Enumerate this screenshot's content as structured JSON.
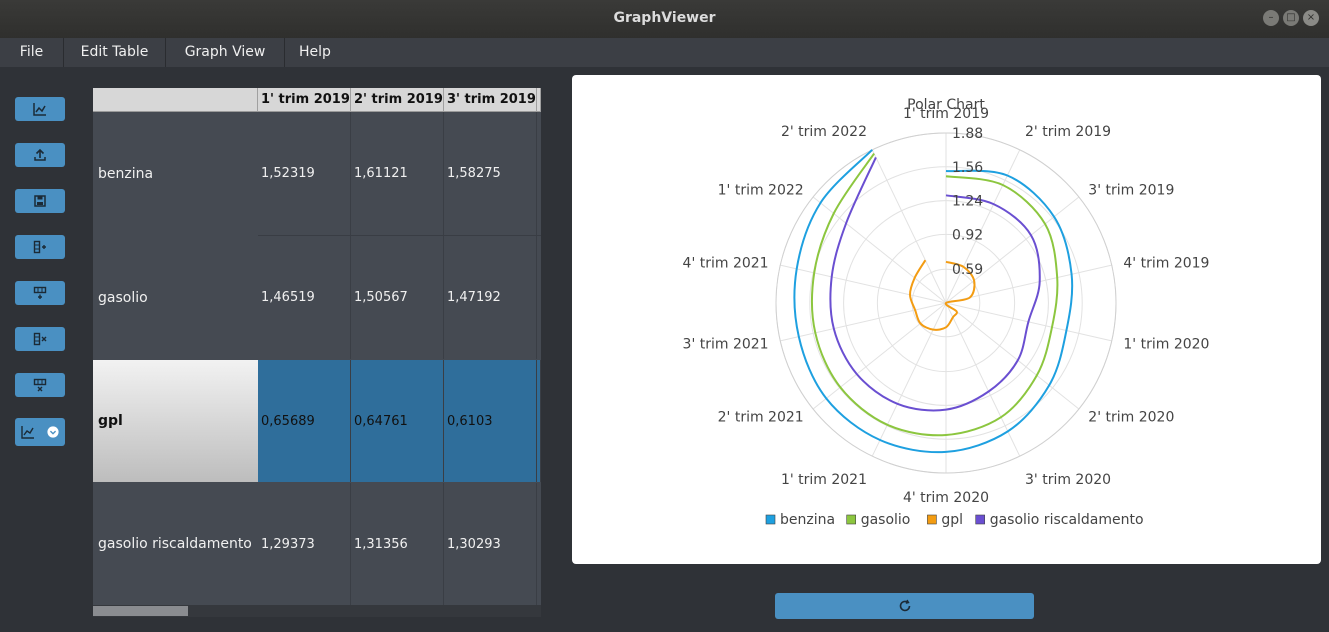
{
  "window": {
    "title": "GraphViewer"
  },
  "menu": [
    {
      "label": "File"
    },
    {
      "label": "Edit Table"
    },
    {
      "label": "Graph View"
    },
    {
      "label": "Help"
    }
  ],
  "toolbar": [
    {
      "icon": "chart-icon"
    },
    {
      "icon": "upload-icon"
    },
    {
      "icon": "save-icon"
    },
    {
      "icon": "add-column-icon"
    },
    {
      "icon": "add-row-icon"
    },
    {
      "icon": "remove-column-icon"
    },
    {
      "icon": "remove-row-icon"
    },
    {
      "icon": "chart-type-dropdown-icon"
    }
  ],
  "table": {
    "columns": [
      "1' trim 2019",
      "2' trim 2019",
      "3' trim 2019"
    ],
    "rows": [
      {
        "name": "benzina",
        "values": [
          "1,52319",
          "1,61121",
          "1,58275"
        ]
      },
      {
        "name": "gasolio",
        "values": [
          "1,46519",
          "1,50567",
          "1,47192"
        ]
      },
      {
        "name": "gpl",
        "values": [
          "0,65689",
          "0,64761",
          "0,6103"
        ]
      },
      {
        "name": "gasolio riscaldamento",
        "values": [
          "1,29373",
          "1,31356",
          "1,30293"
        ]
      }
    ],
    "selected_row": 2
  },
  "colors": {
    "accent": "#4a90c2",
    "selected_row": "#2f6e9b",
    "benzina": "#1ea0e0",
    "gasolio": "#8cc63f",
    "gpl": "#f39c12",
    "gasolio_riscaldamento": "#6a4fd1"
  },
  "chart_data": {
    "type": "polar",
    "title": "Polar Chart",
    "categories": [
      "1' trim 2019",
      "2' trim 2019",
      "3' trim 2019",
      "4' trim 2019",
      "1' trim 2020",
      "2' trim 2020",
      "3' trim 2020",
      "4' trim 2020",
      "1' trim 2021",
      "2' trim 2021",
      "3' trim 2021",
      "4' trim 2021",
      "1' trim 2022",
      "2' trim 2022"
    ],
    "radial_ticks": [
      "0.59",
      "0.92",
      "1.24",
      "1.56",
      "1.88"
    ],
    "radial_range": [
      0.27,
      1.88
    ],
    "series": [
      {
        "name": "benzina",
        "values": [
          1.52,
          1.61,
          1.58,
          1.49,
          1.44,
          1.52,
          1.62,
          1.68,
          1.71,
          1.72,
          1.7,
          1.72,
          1.79,
          1.88
        ]
      },
      {
        "name": "gasolio",
        "values": [
          1.47,
          1.51,
          1.47,
          1.35,
          1.3,
          1.37,
          1.47,
          1.52,
          1.55,
          1.55,
          1.54,
          1.55,
          1.63,
          1.84
        ]
      },
      {
        "name": "gpl",
        "values": [
          0.66,
          0.65,
          0.61,
          0.5,
          0.27,
          0.4,
          0.42,
          0.5,
          0.55,
          0.58,
          0.57,
          0.62,
          0.65,
          0.72
        ]
      },
      {
        "name": "gasolio riscaldamento",
        "values": [
          1.29,
          1.31,
          1.3,
          1.18,
          1.07,
          1.14,
          1.2,
          1.28,
          1.33,
          1.35,
          1.36,
          1.38,
          1.48,
          1.8
        ]
      }
    ],
    "legend_position": "bottom",
    "grid": true
  }
}
